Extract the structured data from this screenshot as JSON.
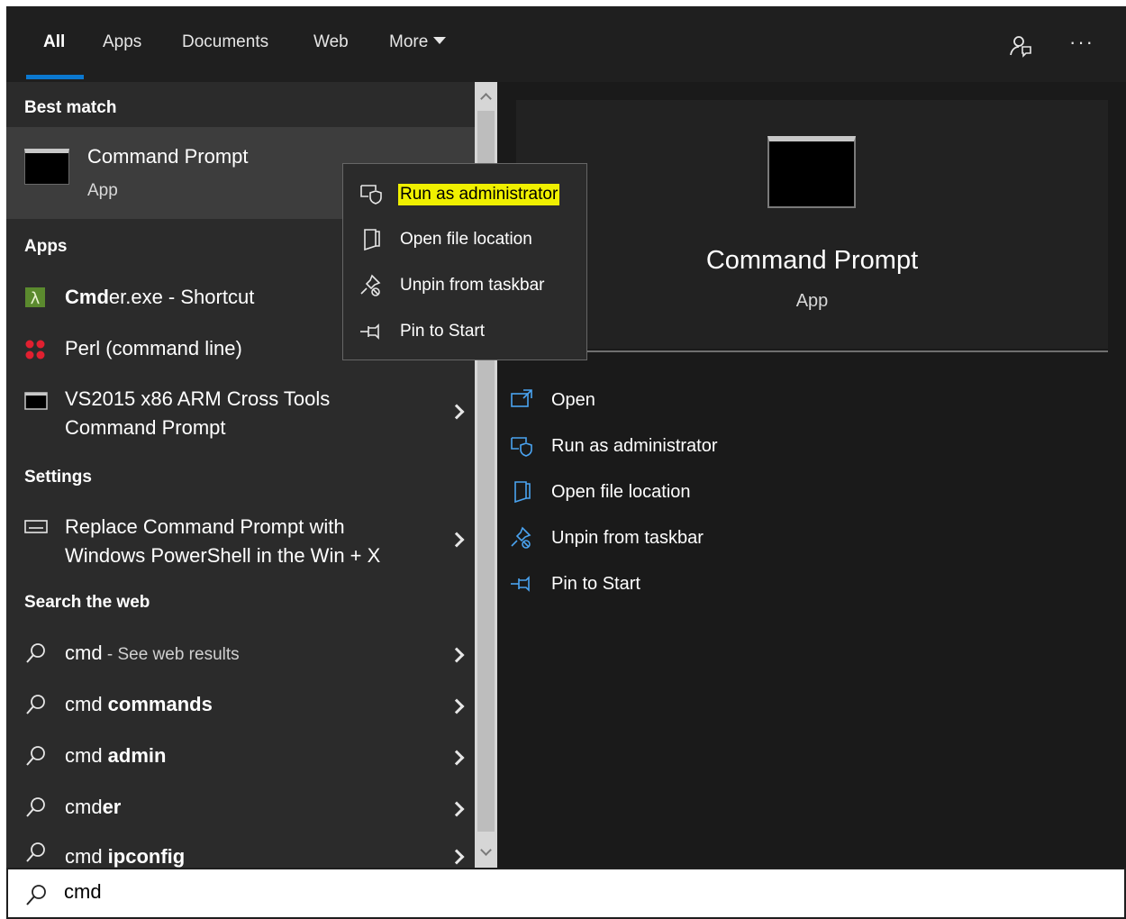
{
  "tabs": [
    {
      "label": "All",
      "active": true
    },
    {
      "label": "Apps"
    },
    {
      "label": "Documents"
    },
    {
      "label": "Web"
    },
    {
      "label": "More"
    }
  ],
  "toolbar": {
    "feedback_icon": "feedback-icon",
    "more_glyph": "···"
  },
  "sections": {
    "best_match": "Best match",
    "apps": "Apps",
    "settings": "Settings",
    "web": "Search the web"
  },
  "best_match": {
    "title": "Command Prompt",
    "type": "App"
  },
  "apps": [
    {
      "prefix": "Cmd",
      "rest": "er.exe - Shortcut",
      "icon": "cmder-lambda-icon"
    },
    {
      "label": "Perl (command line)",
      "icon": "perl-icon"
    },
    {
      "line1": "VS2015 x86 ARM Cross Tools",
      "line2": "Command Prompt",
      "icon": "console-icon"
    }
  ],
  "settings": [
    {
      "line1": "Replace Command Prompt with",
      "line2": "Windows PowerShell in the Win + X",
      "icon": "keyboard-icon"
    }
  ],
  "web_results": [
    {
      "term": "cmd",
      "suffix_sep": " - ",
      "suffix": "See web results"
    },
    {
      "term": "cmd",
      "bold": " commands"
    },
    {
      "term": "cmd",
      "bold": " admin"
    },
    {
      "term": "cmd",
      "bold": "er"
    },
    {
      "term": "cmd",
      "bold": " ipconfig"
    }
  ],
  "context_menu": [
    {
      "label": "Run as administrator",
      "icon": "shield-admin-icon",
      "highlighted": true
    },
    {
      "label": "Open file location",
      "icon": "folder-location-icon"
    },
    {
      "label": "Unpin from taskbar",
      "icon": "unpin-icon"
    },
    {
      "label": "Pin to Start",
      "icon": "pin-icon"
    }
  ],
  "detail": {
    "title": "Command Prompt",
    "type": "App",
    "actions": [
      {
        "label": "Open",
        "icon": "open-icon"
      },
      {
        "label": "Run as administrator",
        "icon": "shield-admin-icon"
      },
      {
        "label": "Open file location",
        "icon": "folder-location-icon"
      },
      {
        "label": "Unpin from taskbar",
        "icon": "unpin-icon"
      },
      {
        "label": "Pin to Start",
        "icon": "pin-icon"
      }
    ]
  },
  "search": {
    "value": "cmd"
  },
  "colors": {
    "accent": "#0b78d0",
    "highlight": "#f0f000",
    "panel": "#2b2b2b",
    "detail": "#1a1a1a"
  }
}
